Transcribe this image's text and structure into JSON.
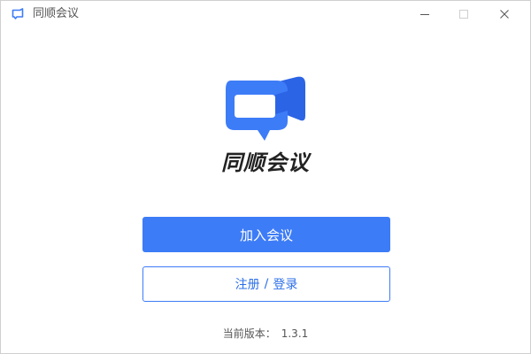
{
  "window": {
    "title": "同顺会议",
    "icon": "video-chat-icon",
    "controls": {
      "minimize_icon": "minimize-icon",
      "maximize_icon": "maximize-icon",
      "close_icon": "close-icon"
    }
  },
  "brand": {
    "name": "同顺会议",
    "logo_icon": "video-chat-bubble-icon",
    "color_primary": "#3d7cf7",
    "color_dark": "#2c64e6"
  },
  "actions": {
    "join_label": "加入会议",
    "register_label": "注册",
    "separator": "/",
    "login_label": "登录"
  },
  "footer": {
    "version_label": "当前版本：",
    "version_number": "1.3.1"
  }
}
